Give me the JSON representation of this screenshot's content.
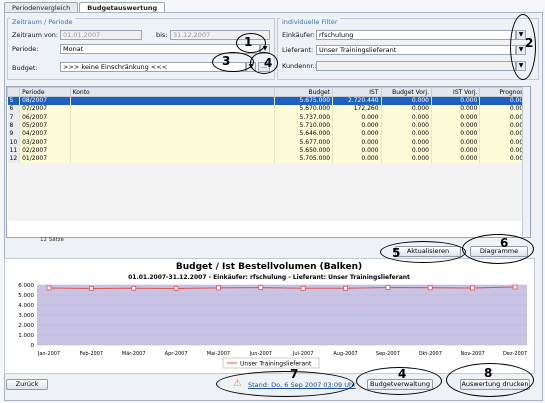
{
  "tabs": [
    {
      "label": "Periodenvergleich"
    },
    {
      "label": "Budgetauswertung"
    }
  ],
  "left_group": {
    "title": "Zeitraum / Periode",
    "zeitraum_label": "Zeitraum von:",
    "zeitraum_from": "01.01.2007",
    "bis_label": "bis:",
    "zeitraum_to": "31.12.2007",
    "periode_label": "Periode:",
    "periode_value": "Monat",
    "budget_label": "Budget:",
    "budget_value": ">>> keine Einschränkung <<<"
  },
  "right_group": {
    "title": "individuelle Filter",
    "einkaeufer_label": "Einkäufer:",
    "einkaeufer_value": "rfschulung",
    "lieferant_label": "Lieferant:",
    "lieferant_value": "Unser Trainingslieferant",
    "kundennr_label": "Kundennr.:",
    "kundennr_value": ""
  },
  "callouts": [
    "1",
    "2",
    "3",
    "4",
    "5",
    "6",
    "4",
    "7",
    "8"
  ],
  "table": {
    "headers": [
      "",
      "Periode",
      "Konto",
      "Budget",
      "IST",
      "Budget Vorj.",
      "IST Vorj.",
      "Prognose"
    ],
    "rows": [
      [
        "5",
        "08/2007",
        "",
        "5.675.000",
        "2.720.440",
        "0.000",
        "0.000",
        "0.000"
      ],
      [
        "6",
        "07/2007",
        "",
        "5.670.000",
        "172.260",
        "0.000",
        "0.000",
        "0.000"
      ],
      [
        "7",
        "06/2007",
        "",
        "5.737.000",
        "0.000",
        "0.000",
        "0.000",
        "0.000"
      ],
      [
        "8",
        "05/2007",
        "",
        "5.710.000",
        "0.000",
        "0.000",
        "0.000",
        "0.000"
      ],
      [
        "9",
        "04/2007",
        "",
        "5.646.000",
        "0.000",
        "0.000",
        "0.000",
        "0.000"
      ],
      [
        "10",
        "03/2007",
        "",
        "5.677.000",
        "0.000",
        "0.000",
        "0.000",
        "0.000"
      ],
      [
        "11",
        "02/2007",
        "",
        "5.650.000",
        "0.000",
        "0.000",
        "0.000",
        "0.000"
      ],
      [
        "12",
        "01/2007",
        "",
        "5.705.000",
        "0.000",
        "0.000",
        "0.000",
        "0.000"
      ]
    ],
    "count": "12 Sätze"
  },
  "buttons": {
    "aktualisieren": "Aktualisieren",
    "diagramme": "Diagramme",
    "zurueck": "Zurück",
    "budgetverwaltung": "Budgetverwaltung",
    "auswertung": "Auswertung drucken"
  },
  "status_text": "Stand: Do, 6 Sep 2007 03:09 Uhr",
  "chart_data": {
    "type": "line",
    "title": "Budget / Ist Bestellvolumen (Balken)",
    "subtitle": "01.01.2007-31.12.2007 - Einkäufer: rfschulung - Lieferant: Unser Trainingslieferant",
    "categories": [
      "Jan-2007",
      "Feb-2007",
      "Mär-2007",
      "Apr-2007",
      "Mai-2007",
      "Jun-2007",
      "Jul-2007",
      "Aug-2007",
      "Sep-2007",
      "Okt-2007",
      "Nov-2007",
      "Dez-2007"
    ],
    "yticks": [
      "6.000",
      "5.000",
      "4.000",
      "3.000",
      "2.000",
      "1.000",
      "0"
    ],
    "ylim": [
      0,
      6000
    ],
    "series": [
      {
        "name": "Unser Trainingslieferant",
        "color": "#e05050",
        "values": [
          5705,
          5650,
          5677,
          5646,
          5710,
          5737,
          5670,
          5675,
          5750,
          5720,
          5700,
          5800
        ]
      }
    ],
    "legend": "bottom"
  },
  "colors": {
    "selection": "#1f5fbf",
    "row": "#fbfbd8",
    "plot": "#c9c4e6",
    "accent": "#3d6fb4"
  }
}
